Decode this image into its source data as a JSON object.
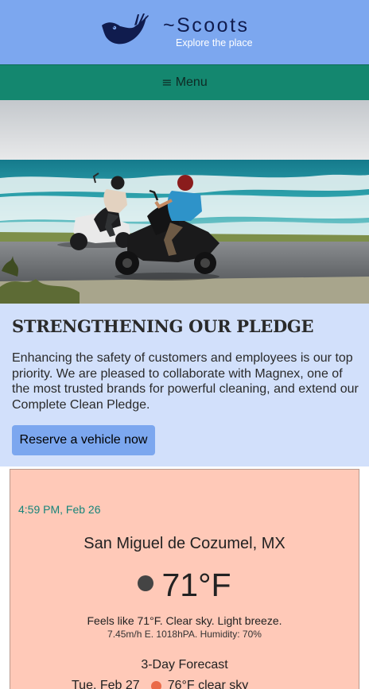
{
  "header": {
    "brand_name": "~Scoots",
    "tagline": "Explore the place",
    "logo_icon": "bird-logo-icon",
    "colors": {
      "background": "#7ca7ef",
      "logo": "#101c4e"
    }
  },
  "nav": {
    "menu_icon": "≡",
    "menu_label": "Menu",
    "colors": {
      "background": "#14876f"
    }
  },
  "hero": {
    "image_subject": "two-riders-on-scooters-by-the-sea"
  },
  "pledge": {
    "title": "STRENGTHENING OUR PLEDGE",
    "body": "Enhancing the safety of customers and employees is our top priority. We are pleased to collaborate with Magnex, one of the most trusted brands for powerful cleaning, and extend our Complete Clean Pledge.",
    "button_label": "Reserve a vehicle now",
    "colors": {
      "background": "#d2e0fb",
      "button": "#7ca7ef"
    }
  },
  "weather": {
    "time": "4:59 PM, Feb 26",
    "city": "San Miguel de Cozumel, MX",
    "condition_icon": "weather-dot-icon",
    "temperature": "71°F",
    "feels_like": "Feels like 71°F. Clear sky. Light breeze.",
    "details": "7.45m/h E. 1018hPA. Humidity: 70%",
    "forecast_title": "3-Day Forecast",
    "forecast": [
      {
        "day": "Tue, Feb 27",
        "summary": "76°F clear sky",
        "dot_color": "#ea6b49"
      }
    ],
    "colors": {
      "background": "#ffc9b8",
      "time": "#17857a"
    }
  }
}
